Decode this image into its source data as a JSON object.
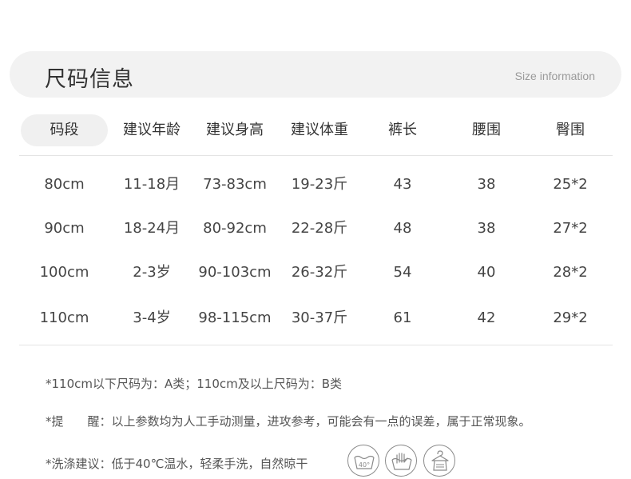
{
  "header": {
    "title": "尺码信息",
    "subtitle": "Size information"
  },
  "table": {
    "columns": [
      "码段",
      "建议年龄",
      "建议身高",
      "建议体重",
      "裤长",
      "腰围",
      "臀围"
    ],
    "rows": [
      [
        "80cm",
        "11-18月",
        "73-83cm",
        "19-23斤",
        "43",
        "38",
        "25*2"
      ],
      [
        "90cm",
        "18-24月",
        "80-92cm",
        "22-28斤",
        "48",
        "38",
        "27*2"
      ],
      [
        "100cm",
        "2-3岁",
        "90-103cm",
        "26-32斤",
        "54",
        "40",
        "28*2"
      ],
      [
        "110cm",
        "3-4岁",
        "98-115cm",
        "30-37斤",
        "61",
        "42",
        "29*2"
      ]
    ]
  },
  "notes": {
    "size_class": "*110cm以下尺码为：A类；110cm及以上尺码为：B类",
    "reminder_label": "*提　　醒：",
    "reminder_text": "以上参数均为人工手动测量，进攻参考，可能会有一点的误差，属于正常现象。",
    "wash": "*洗涤建议：低于40℃温水，轻柔手洗，自然晾干"
  },
  "care_icons": [
    {
      "icon": "wash-40-icon",
      "label": "40°"
    },
    {
      "icon": "hand-wash-icon"
    },
    {
      "icon": "hang-dry-icon"
    }
  ],
  "colors": {
    "header_bg": "#f2f2f2",
    "pill_bg": "#f0f0f0",
    "divider": "#e4e4e4",
    "text": "#444444"
  }
}
